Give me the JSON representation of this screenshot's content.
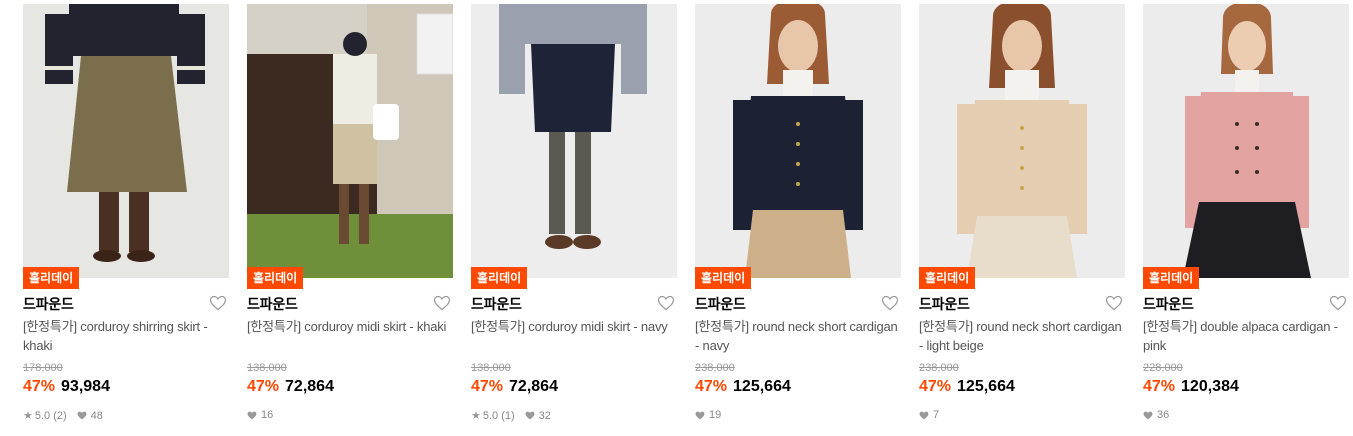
{
  "products": [
    {
      "badge": "홀리데이",
      "brand": "드파운드",
      "title": "[한정특가] corduroy shirring skirt - khaki",
      "original_price": "178,000",
      "discount": "47%",
      "price": "93,984",
      "rating": "5.0 (2)",
      "likes": "48",
      "has_rating": true,
      "image": {
        "bg": "#e6e6e3",
        "top": "#23222f",
        "bottom": "#7a6e4d",
        "shoes": "#4a3022"
      }
    },
    {
      "badge": "홀리데이",
      "brand": "드파운드",
      "title": "[한정특가] corduroy midi skirt - khaki",
      "original_price": "138,000",
      "discount": "47%",
      "price": "72,864",
      "rating": "",
      "likes": "16",
      "has_rating": false,
      "image": {
        "bg": "#c9c2b4",
        "top": "#efece4",
        "bottom": "#cfc2a3",
        "shoes": "#6a4a33"
      }
    },
    {
      "badge": "홀리데이",
      "brand": "드파운드",
      "title": "[한정특가] corduroy midi skirt - navy",
      "original_price": "138,000",
      "discount": "47%",
      "price": "72,864",
      "rating": "5.0 (1)",
      "likes": "32",
      "has_rating": true,
      "image": {
        "bg": "#ededed",
        "top": "#9aa0ad",
        "bottom": "#1f2337",
        "shoes": "#5a3a26"
      }
    },
    {
      "badge": "홀리데이",
      "brand": "드파운드",
      "title": "[한정특가] round neck short cardigan - navy",
      "original_price": "238,000",
      "discount": "47%",
      "price": "125,664",
      "rating": "",
      "likes": "19",
      "has_rating": false,
      "image": {
        "bg": "#ececec",
        "top": "#1c2134",
        "bottom": "#cdb08a",
        "shoes": "#000000"
      }
    },
    {
      "badge": "홀리데이",
      "brand": "드파운드",
      "title": "[한정특가] round neck short cardigan - light beige",
      "original_price": "238,000",
      "discount": "47%",
      "price": "125,664",
      "rating": "",
      "likes": "7",
      "has_rating": false,
      "image": {
        "bg": "#ececec",
        "top": "#e4cdb0",
        "bottom": "#e8dccb",
        "shoes": "#000000"
      }
    },
    {
      "badge": "홀리데이",
      "brand": "드파운드",
      "title": "[한정특가] double alpaca cardigan - pink",
      "original_price": "228,000",
      "discount": "47%",
      "price": "120,384",
      "rating": "",
      "likes": "36",
      "has_rating": false,
      "image": {
        "bg": "#ececec",
        "top": "#e3a3a0",
        "bottom": "#1e1e22",
        "shoes": "#000000"
      }
    }
  ],
  "icons": {
    "wishlist": "heart-outline-icon",
    "star": "star-icon",
    "likes": "heart-filled-icon"
  },
  "colors": {
    "accent": "#ff4800",
    "strike": "#999999",
    "meta": "#888888"
  }
}
